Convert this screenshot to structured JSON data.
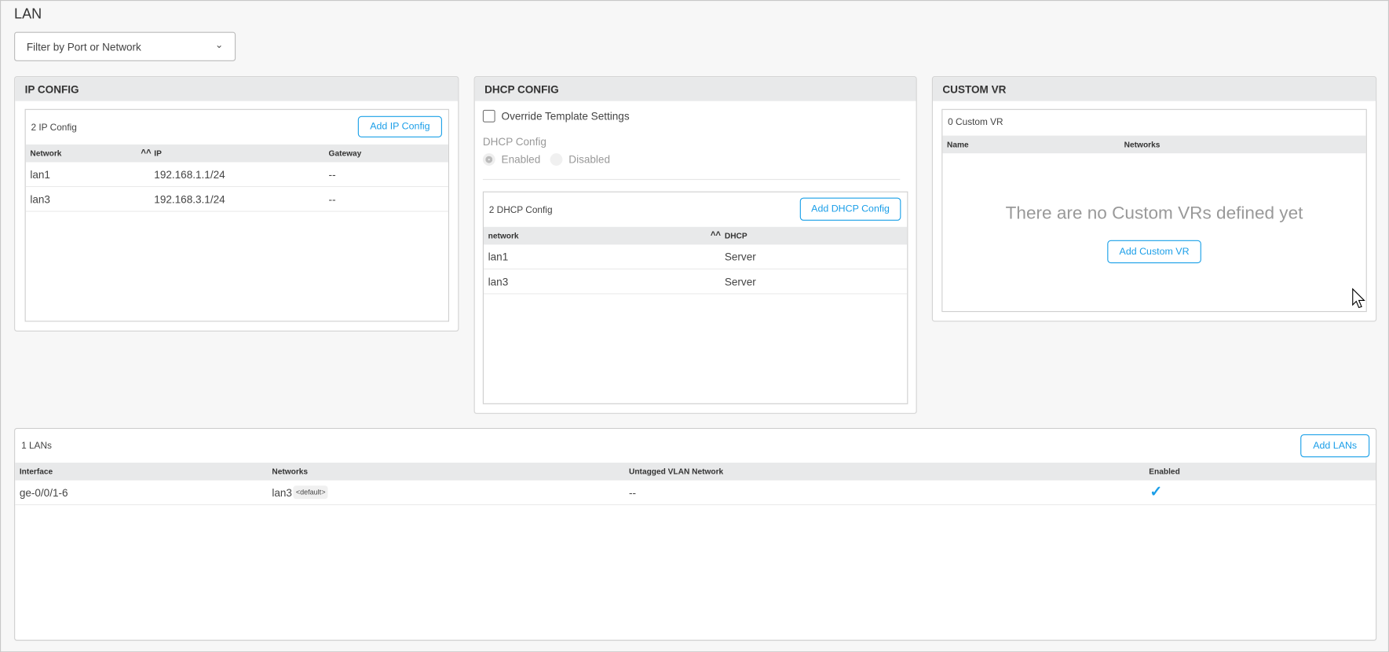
{
  "page_title": "LAN",
  "filter": {
    "placeholder": "Filter by Port or Network"
  },
  "ip_config": {
    "title": "IP CONFIG",
    "count": "2 IP Config",
    "add_button": "Add IP Config",
    "columns": [
      "Network",
      "IP",
      "Gateway"
    ],
    "rows": [
      {
        "network": "lan1",
        "ip": "192.168.1.1/24",
        "gateway": "--"
      },
      {
        "network": "lan3",
        "ip": "192.168.3.1/24",
        "gateway": "--"
      }
    ]
  },
  "dhcp_config": {
    "title": "DHCP CONFIG",
    "override_label": "Override Template Settings",
    "override_checked": false,
    "radio_label": "DHCP Config",
    "radio_options": [
      "Enabled",
      "Disabled"
    ],
    "radio_selected": "Enabled",
    "count": "2 DHCP Config",
    "add_button": "Add DHCP Config",
    "columns": [
      "network",
      "DHCP"
    ],
    "rows": [
      {
        "network": "lan1",
        "dhcp": "Server"
      },
      {
        "network": "lan3",
        "dhcp": "Server"
      }
    ]
  },
  "custom_vr": {
    "title": "CUSTOM VR",
    "count": "0 Custom VR",
    "columns": [
      "Name",
      "Networks"
    ],
    "empty_message": "There are no Custom VRs defined yet",
    "add_button": "Add Custom VR"
  },
  "lans": {
    "count": "1 LANs",
    "add_button": "Add LANs",
    "columns": [
      "Interface",
      "Networks",
      "Untagged VLAN Network",
      "Enabled"
    ],
    "rows": [
      {
        "interface": "ge-0/0/1-6",
        "network": "lan3",
        "badge": "<default>",
        "untagged": "--",
        "enabled": true
      }
    ]
  },
  "colors": {
    "accent": "#1a9ee8"
  }
}
